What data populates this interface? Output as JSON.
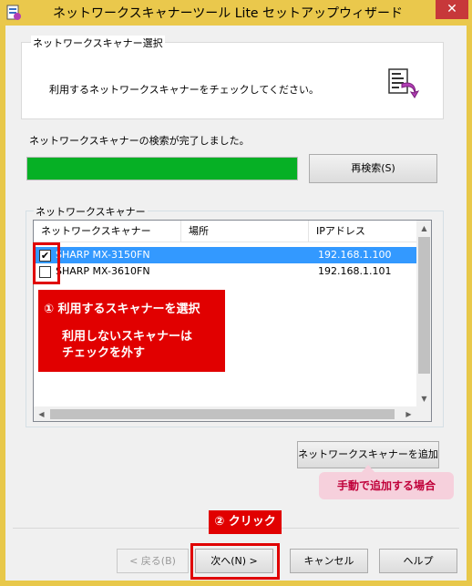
{
  "window": {
    "title": "ネットワークスキャナーツール Lite セットアップウィザード",
    "close_glyph": "✕"
  },
  "header": {
    "group_label": "ネットワークスキャナー選択",
    "instruction": "利用するネットワークスキャナーをチェックしてください。"
  },
  "search": {
    "status": "ネットワークスキャナーの検索が完了しました。",
    "progress_percent": 100,
    "progress_color": "#06b025",
    "rescan_label": "再検索(S)"
  },
  "scanners": {
    "group_label": "ネットワークスキャナー",
    "columns": [
      "ネットワークスキャナー",
      "場所",
      "IPアドレス"
    ],
    "rows": [
      {
        "checked": true,
        "check_glyph": "✔",
        "name": "SHARP MX-3150FN",
        "location": "",
        "ip": "192.168.1.100",
        "selected": true
      },
      {
        "checked": false,
        "check_glyph": "",
        "name": "SHARP MX-3610FN",
        "location": "",
        "ip": "192.168.1.101",
        "selected": false
      }
    ],
    "add_label": "ネットワークスキャナーを追加(A)"
  },
  "annotations": {
    "callout_line1": "① 利用するスキャナーを選択",
    "callout_line2": "利用しないスキャナーは",
    "callout_line3": "チェックを外す",
    "manual_add": "手動で追加する場合",
    "click_label": "② クリック",
    "accent_red": "#e10000"
  },
  "footer": {
    "back_label": "< 戻る(B)",
    "next_label": "次へ(N) >",
    "cancel_label": "キャンセル",
    "help_label": "ヘルプ"
  }
}
